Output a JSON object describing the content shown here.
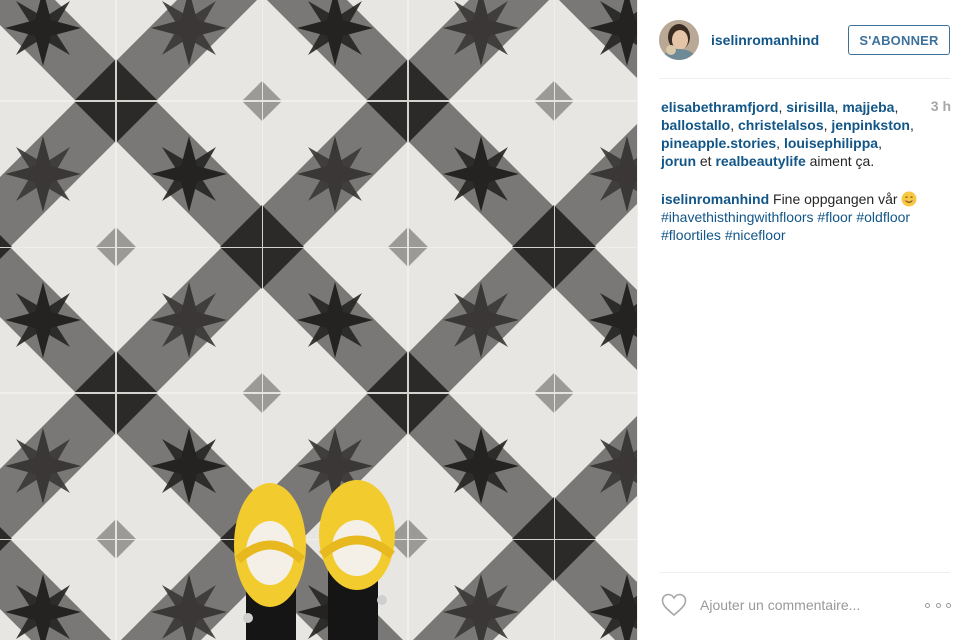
{
  "post": {
    "username": "iselinromanhind",
    "follow_label": "S'ABONNER",
    "time": "3 h",
    "likes": {
      "users": [
        "elisabethramfjord",
        "sirisilla",
        "majjeba",
        "ballostallo",
        "christelalsos",
        "jenpinkston",
        "pineapple.stories",
        "louisephilippa",
        "jorun",
        "realbeautylife"
      ],
      "and_word": "et",
      "suffix": "aiment ça."
    },
    "caption": {
      "username": "iselinromanhind",
      "text": "Fine oppgangen vår",
      "emoji": "smiling-face-emoji",
      "hashtags": [
        "#ihavethisthingwithfloors",
        "#floor",
        "#oldfloor",
        "#floortiles",
        "#nicefloor"
      ]
    },
    "comment_placeholder": "Ajouter un commentaire...",
    "icons": {
      "like": "heart-icon",
      "more": "ellipsis-icon"
    },
    "colors": {
      "link": "#125688",
      "button": "#3f729b",
      "muted": "#999999",
      "shoe": "#f2cc2e"
    }
  }
}
